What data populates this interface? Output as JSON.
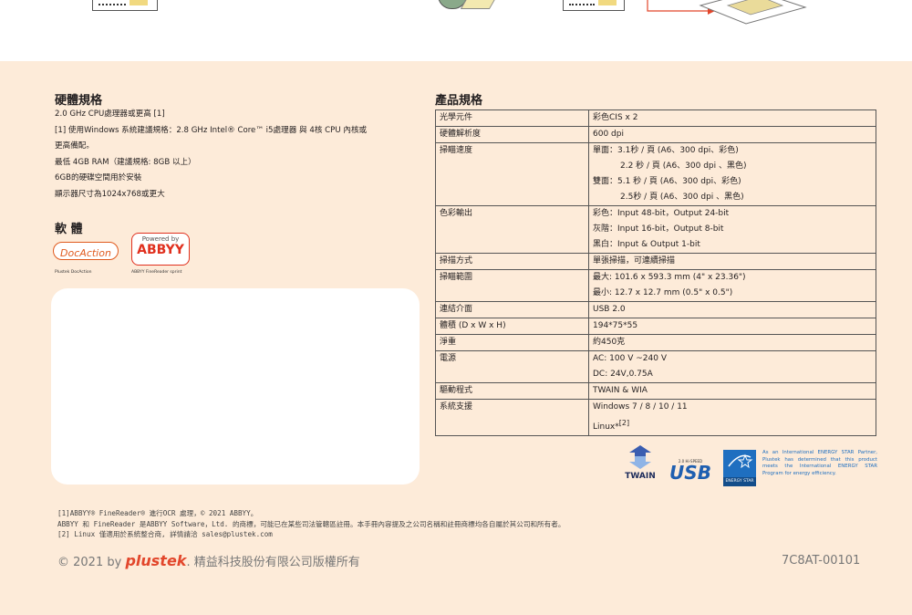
{
  "hardware": {
    "title": "硬體規格",
    "lines": [
      "2.0 GHz CPU處理器或更高 [1]",
      "[1] 使用Windows 系統建議規格：2.8 GHz  Intel® Core™ i5處理器 與 4核 CPU 內核或",
      "更高備配。",
      "最低 4GB RAM（建議規格: 8GB 以上）",
      "6GB的硬碟空間用於安裝",
      "顯示器尺寸為1024x768或更大"
    ]
  },
  "software": {
    "title": "軟 體",
    "docaction_logo": "DocAction",
    "docaction_caption": "Plustek DocAction",
    "abbyy_powered": "Powered by",
    "abbyy_logo": "ABBYY",
    "abbyy_caption": "ABBYY FineReader sprint"
  },
  "product": {
    "title": "產品規格",
    "rows": [
      {
        "key": "光學元件",
        "lines": [
          "彩色CIS x 2"
        ]
      },
      {
        "key": "硬體解析度",
        "lines": [
          "600 dpi"
        ]
      },
      {
        "key": "掃瞄速度",
        "lines": [
          "單面：3.1秒 / 頁 (A6、300 dpi、彩色)",
          "2.2 秒 / 頁 (A6、300 dpi 、黑色)",
          "雙面：5.1 秒 / 頁 (A6、300 dpi、彩色)",
          "2.5秒 / 頁 (A6、300 dpi 、黑色)"
        ]
      },
      {
        "key": "色彩輸出",
        "lines": [
          "彩色：Input 48-bit，Output 24-bit",
          "灰階：Input 16-bit，Output 8-bit",
          "黑白：Input & Output 1-bit"
        ]
      },
      {
        "key": "掃描方式",
        "lines": [
          "單張掃描，可連續掃描"
        ]
      },
      {
        "key": "掃瞄範圍",
        "lines": [
          "最大: 101.6 x 593.3 mm (4\" x 23.36\")",
          "最小: 12.7 x 12.7 mm (0.5\" x 0.5\")"
        ]
      },
      {
        "key": "連結介面",
        "lines": [
          "USB 2.0"
        ]
      },
      {
        "key": "體積 (D x W x H)",
        "lines": [
          "194*75*55"
        ]
      },
      {
        "key": "淨重",
        "lines": [
          "約450克"
        ]
      },
      {
        "key": "電源",
        "lines": [
          "AC: 100 V ~240 V",
          "DC: 24V,0.75A"
        ]
      },
      {
        "key": "驅動程式",
        "lines": [
          "TWAIN & WIA"
        ]
      },
      {
        "key": "系統支援",
        "lines": [
          "Windows 7 / 8 / 10 / 11"
        ],
        "last": "Linux*",
        "sup": "[2]"
      }
    ]
  },
  "logos": {
    "twain": "TWAIN",
    "usb": "USB",
    "usb_speed": "2.0 Hi-SPEED",
    "energy_star": "ENERGY STAR",
    "energy_text": "As an International ENERGY STAR Partner, Plustek has determined that this product meets the International ENERGY STAR Program for energy efficiency."
  },
  "footnotes": [
    "[1]ABBYY® FineReader® 進行OCR 處理，© 2021 ABBYY。",
    "ABBYY 和 FineReader 是ABBYY Software，Ltd. 的商標，可能已在某些司法管轄區註冊。本手冊內容提及之公司名稱和註冊商標均各自屬於其公司和所有者。",
    "[2] Linux 僅適用於系統整合商, 詳情請洽 sales@plustek.com"
  ],
  "copyright": {
    "prefix": "© 2021 by",
    "brand": "plustek",
    "suffix": ". 精益科技股份有限公司版權所有"
  },
  "code": "7C8AT-00101"
}
